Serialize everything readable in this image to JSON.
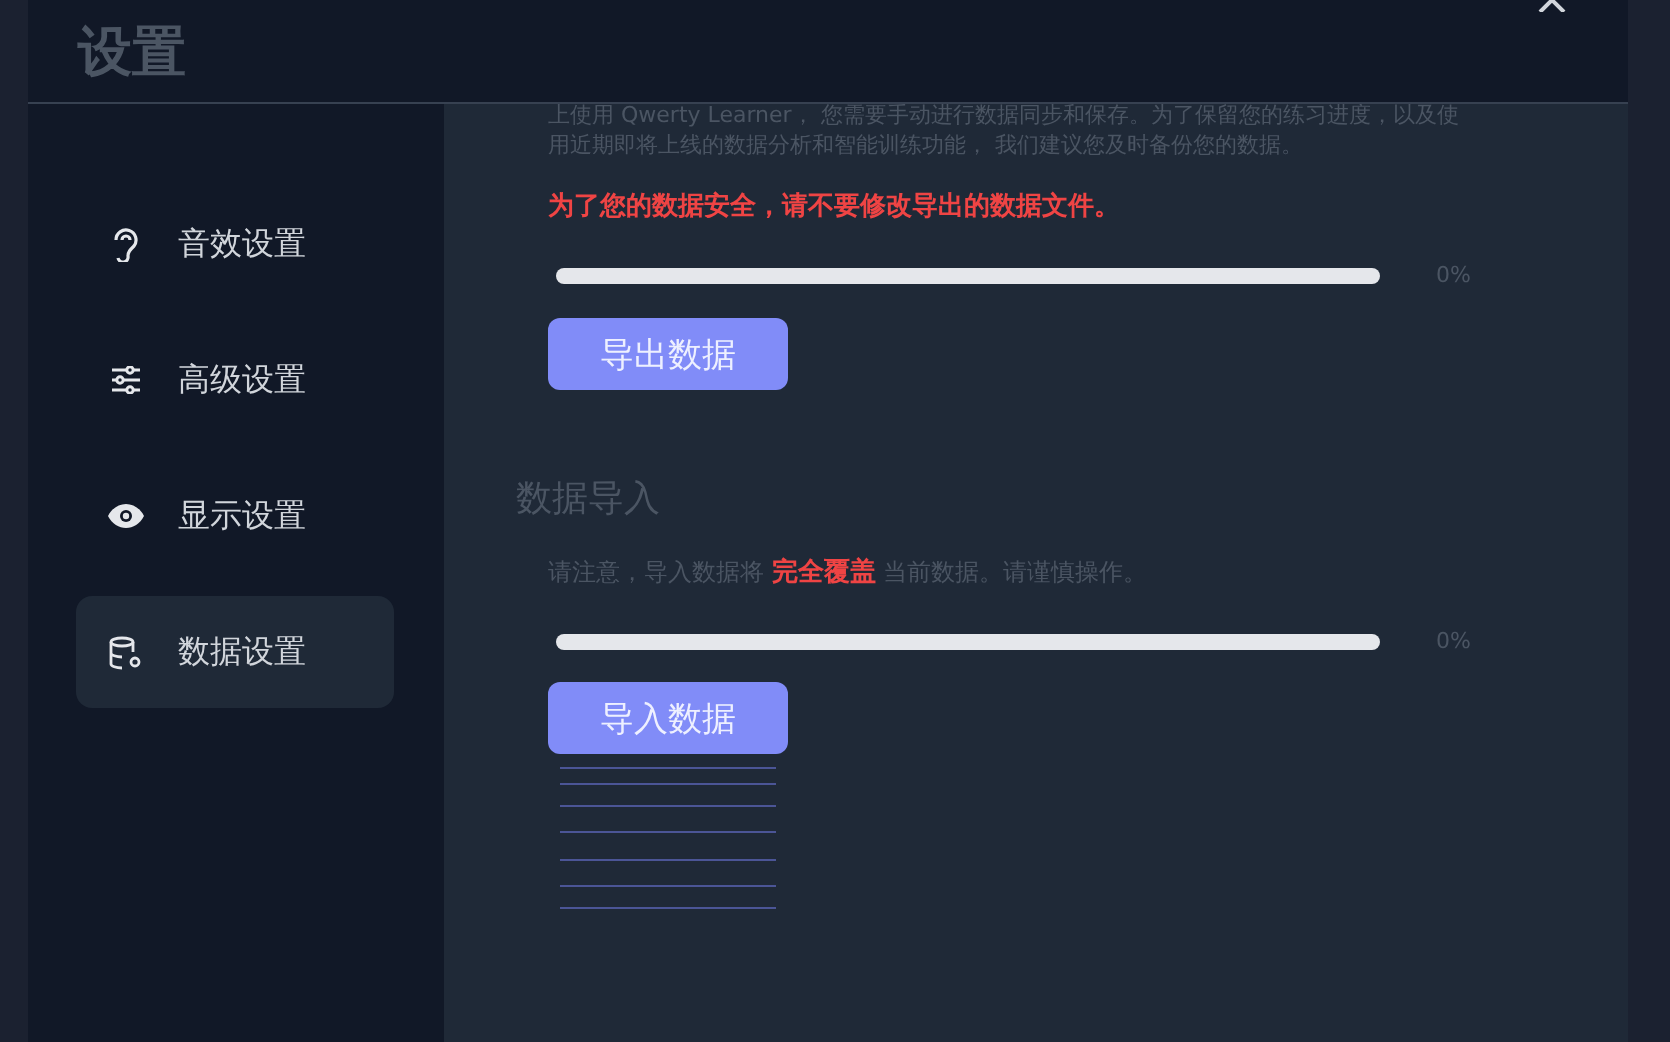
{
  "dialog": {
    "title": "设置"
  },
  "sidebar": {
    "items": [
      {
        "label": "音效设置",
        "selected": false
      },
      {
        "label": "高级设置",
        "selected": false
      },
      {
        "label": "显示设置",
        "selected": false
      },
      {
        "label": "数据设置",
        "selected": true
      }
    ]
  },
  "export": {
    "intro_lines": [
      "上使用 Qwerty Learner， 您需要手动进行数据同步和保存。为了保留您的练习进度，以及使",
      "用近期即将上线的数据分析和智能训练功能， 我们建议您及时备份您的数据。"
    ],
    "warning": "为了您的数据安全，请不要修改导出的数据文件。",
    "progress": {
      "level": 0,
      "reading": "0%"
    },
    "button": "导出数据"
  },
  "import": {
    "heading": "数据导入",
    "note": "请注意，导入数据将 **完全覆盖** 当前数据。请谨慎操作。",
    "progress": {
      "level": 0,
      "reading": "0%"
    },
    "button": "导入数据"
  }
}
